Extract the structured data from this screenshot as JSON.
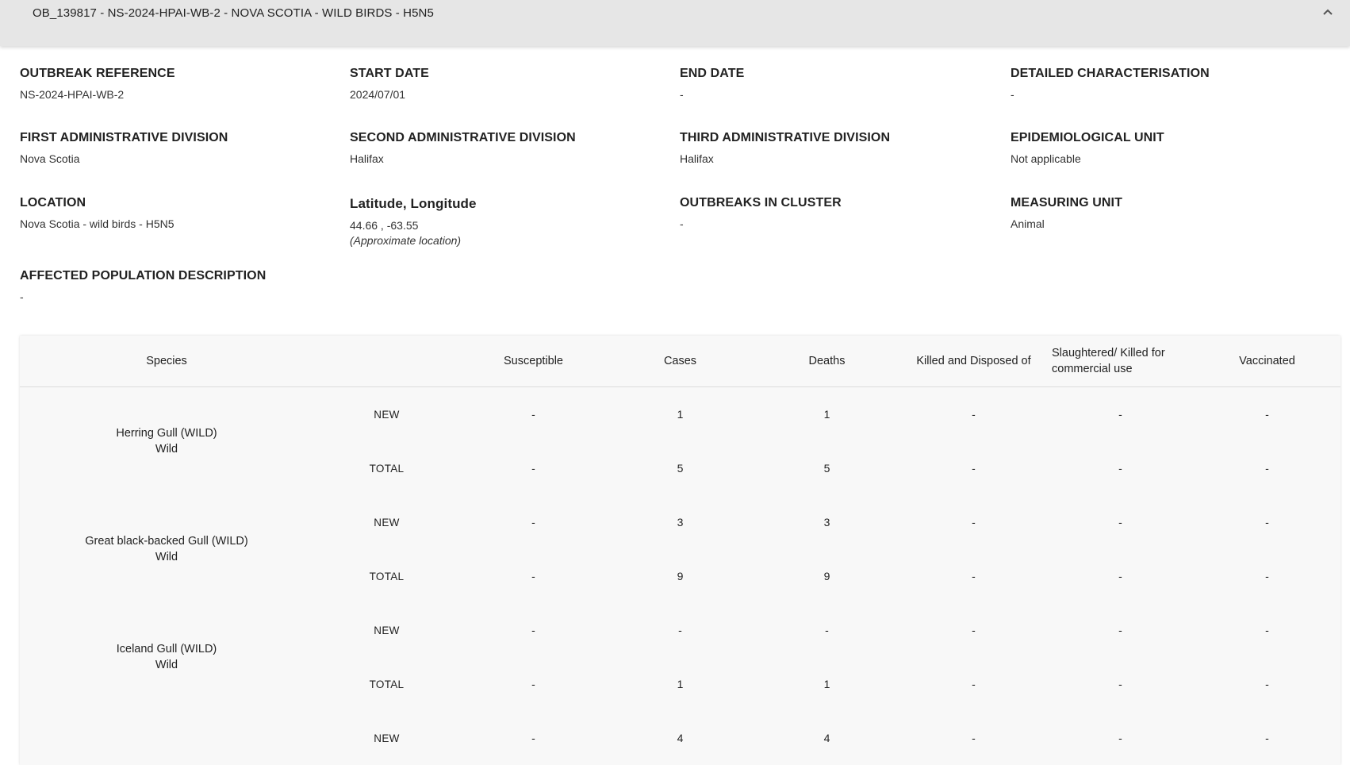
{
  "header": {
    "title": "OB_139817 - NS-2024-HPAI-WB-2 - NOVA SCOTIA - WILD BIRDS - H5N5",
    "collapse_icon": "chevron-up-icon"
  },
  "details": {
    "outbreak_reference": {
      "label": "OUTBREAK REFERENCE",
      "value": "NS-2024-HPAI-WB-2"
    },
    "start_date": {
      "label": "START DATE",
      "value": "2024/07/01"
    },
    "end_date": {
      "label": "END DATE",
      "value": "-"
    },
    "detailed_characterisation": {
      "label": "DETAILED CHARACTERISATION",
      "value": "-"
    },
    "first_admin": {
      "label": "FIRST ADMINISTRATIVE DIVISION",
      "value": "Nova Scotia"
    },
    "second_admin": {
      "label": "SECOND ADMINISTRATIVE DIVISION",
      "value": "Halifax"
    },
    "third_admin": {
      "label": "THIRD ADMINISTRATIVE DIVISION",
      "value": "Halifax"
    },
    "epi_unit": {
      "label": "EPIDEMIOLOGICAL UNIT",
      "value": "Not applicable"
    },
    "location": {
      "label": "LOCATION",
      "value": "Nova Scotia - wild birds - H5N5"
    },
    "lat_long": {
      "label": "Latitude, Longitude",
      "value": "44.66 , -63.55",
      "note": "(Approximate location)"
    },
    "outbreaks_in_cluster": {
      "label": "OUTBREAKS IN CLUSTER",
      "value": "-"
    },
    "measuring_unit": {
      "label": "MEASURING UNIT",
      "value": "Animal"
    },
    "affected_population": {
      "label": "AFFECTED POPULATION DESCRIPTION",
      "value": "-"
    }
  },
  "table": {
    "headers": {
      "species": "Species",
      "susceptible": "Susceptible",
      "cases": "Cases",
      "deaths": "Deaths",
      "killed": "Killed and Disposed of",
      "slaughtered": "Slaughtered/ Killed for commercial use",
      "vaccinated": "Vaccinated"
    },
    "rows": [
      {
        "species": "Herring Gull (WILD)",
        "type": "Wild",
        "new": {
          "label": "NEW",
          "susceptible": "-",
          "cases": "1",
          "deaths": "1",
          "killed": "-",
          "slaughtered": "-",
          "vaccinated": "-"
        },
        "total": {
          "label": "TOTAL",
          "susceptible": "-",
          "cases": "5",
          "deaths": "5",
          "killed": "-",
          "slaughtered": "-",
          "vaccinated": "-"
        }
      },
      {
        "species": "Great black-backed Gull (WILD)",
        "type": "Wild",
        "new": {
          "label": "NEW",
          "susceptible": "-",
          "cases": "3",
          "deaths": "3",
          "killed": "-",
          "slaughtered": "-",
          "vaccinated": "-"
        },
        "total": {
          "label": "TOTAL",
          "susceptible": "-",
          "cases": "9",
          "deaths": "9",
          "killed": "-",
          "slaughtered": "-",
          "vaccinated": "-"
        }
      },
      {
        "species": "Iceland Gull (WILD)",
        "type": "Wild",
        "new": {
          "label": "NEW",
          "susceptible": "-",
          "cases": "-",
          "deaths": "-",
          "killed": "-",
          "slaughtered": "-",
          "vaccinated": "-"
        },
        "total": {
          "label": "TOTAL",
          "susceptible": "-",
          "cases": "1",
          "deaths": "1",
          "killed": "-",
          "slaughtered": "-",
          "vaccinated": "-"
        }
      },
      {
        "species": "",
        "type": "",
        "new": {
          "label": "NEW",
          "susceptible": "-",
          "cases": "4",
          "deaths": "4",
          "killed": "-",
          "slaughtered": "-",
          "vaccinated": "-"
        },
        "total": null
      }
    ]
  }
}
